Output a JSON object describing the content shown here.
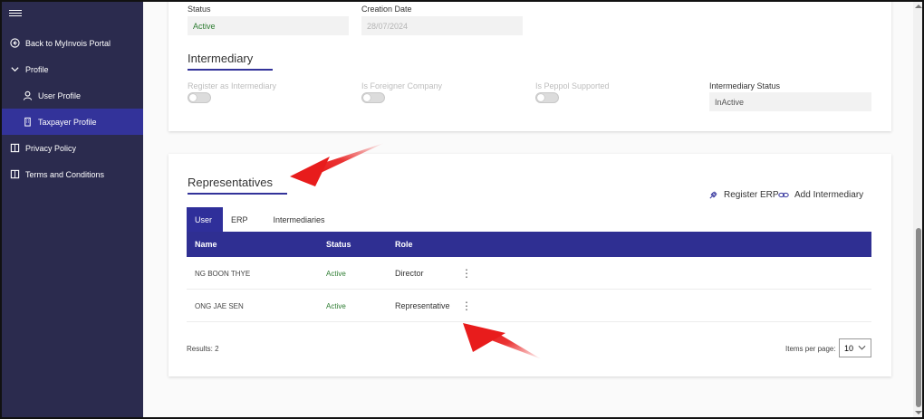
{
  "sidebar": {
    "items": [
      {
        "label": "Back to MyInvois Portal",
        "icon": "circle-arrow-left-icon"
      },
      {
        "label": "Profile",
        "icon": "chevron-down-icon"
      },
      {
        "label": "User Profile",
        "icon": "user-icon"
      },
      {
        "label": "Taxpayer Profile",
        "icon": "building-icon"
      },
      {
        "label": "Privacy Policy",
        "icon": "book-icon"
      },
      {
        "label": "Terms and Conditions",
        "icon": "book-icon"
      }
    ]
  },
  "details": {
    "status_label": "Status",
    "status_value": "Active",
    "creation_label": "Creation Date",
    "creation_value": "28/07/2024"
  },
  "intermediary": {
    "title": "Intermediary",
    "register_label": "Register as Intermediary",
    "foreigner_label": "Is Foreigner Company",
    "peppol_label": "Is Peppol Supported",
    "status_label": "Intermediary Status",
    "status_value": "InActive"
  },
  "representatives": {
    "title": "Representatives",
    "register_erp": "Register ERP",
    "add_intermediary": "Add Intermediary",
    "tabs": [
      {
        "label": "User"
      },
      {
        "label": "ERP"
      },
      {
        "label": "Intermediaries"
      }
    ],
    "columns": {
      "name": "Name",
      "status": "Status",
      "role": "Role"
    },
    "rows": [
      {
        "name": "NG BOON THYE",
        "status": "Active",
        "role": "Director"
      },
      {
        "name": "ONG JAE SEN",
        "status": "Active",
        "role": "Representative"
      }
    ],
    "results": "Results: 2",
    "items_per_page_label": "Items per page:",
    "items_per_page_value": "10"
  },
  "colors": {
    "sidebar_bg": "#2b2b4e",
    "accent": "#2f2f92",
    "status_active": "#2e7d32",
    "annotation": "#e81c1c"
  }
}
